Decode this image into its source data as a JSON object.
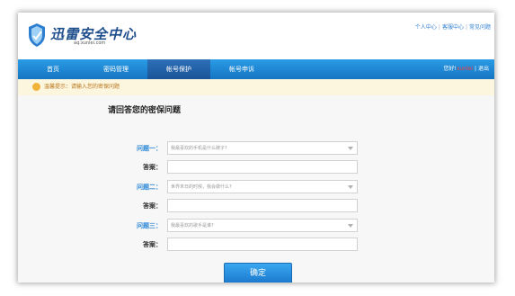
{
  "brand": {
    "name": "迅雷安全中心",
    "url": "aq.xunlei.com"
  },
  "top_links": [
    "个人中心",
    "客服中心",
    "常见问题"
  ],
  "nav": {
    "items": [
      {
        "label": "首页"
      },
      {
        "label": "密码管理"
      },
      {
        "label": "帐号保护"
      },
      {
        "label": "帐号申诉"
      }
    ],
    "active_index": 2,
    "user_prefix": "您好!",
    "user_name": "xunlei",
    "logout": "退出"
  },
  "notice": {
    "text": "温馨提示：请输入您的密保问题"
  },
  "form": {
    "title": "请回答您的密保问题",
    "questions": [
      {
        "label": "问题一：",
        "value": "我最喜欢的手机是什么牌子?",
        "answer_label": "答案："
      },
      {
        "label": "问题二：",
        "value": "世界末日的时候，我会做什么?",
        "answer_label": "答案："
      },
      {
        "label": "问题三：",
        "value": "我最喜欢的歌手是谁?",
        "answer_label": "答案："
      }
    ],
    "submit": "确定"
  },
  "colors": {
    "nav_blue": "#1f86d6",
    "question_label": "#2b87d6",
    "notice_bg": "#fdf6df"
  }
}
